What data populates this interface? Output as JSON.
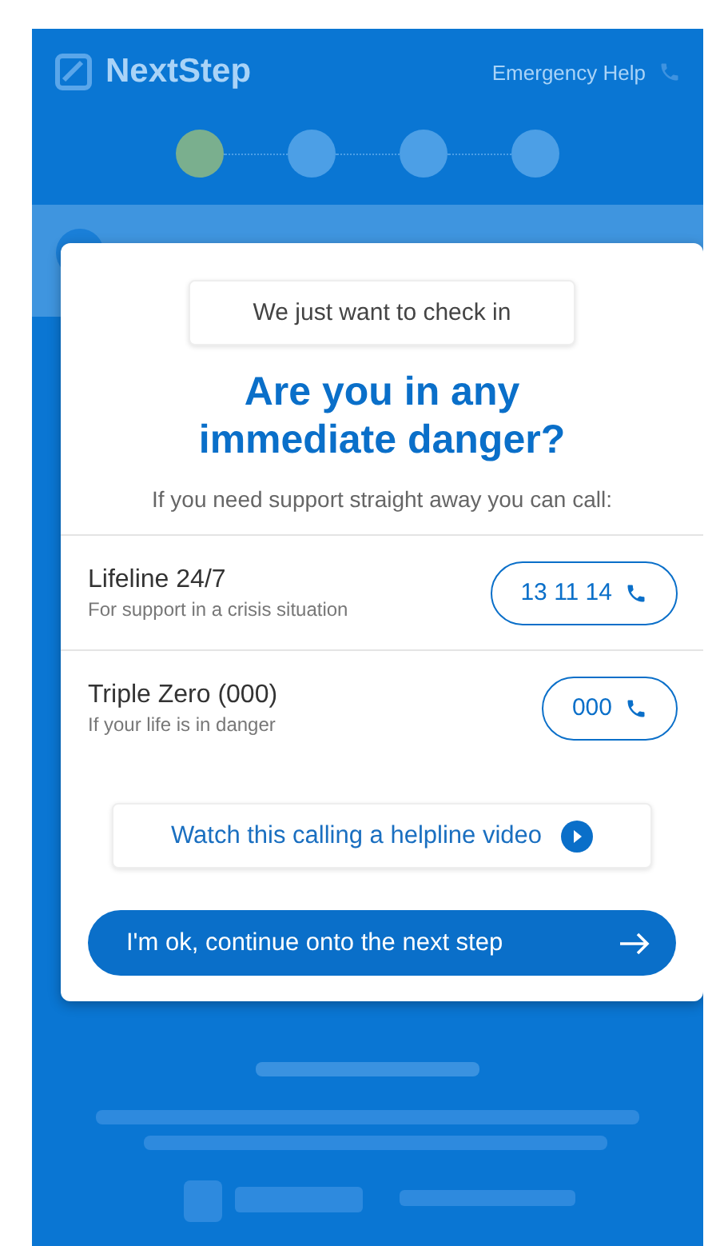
{
  "header": {
    "brand": "NextStep",
    "emergency_link": "Emergency Help"
  },
  "stepper": {
    "steps": [
      {
        "current": true
      },
      {
        "current": false
      },
      {
        "current": false
      },
      {
        "current": false
      }
    ]
  },
  "dialog": {
    "bubble": "We just want to check in",
    "title": "Are you in any immediate danger?",
    "intro": "If you need support straight away you can call:",
    "helplines": [
      {
        "name": "Lifeline 24/7",
        "description": "For support in a crisis situation",
        "number": "13 11 14"
      },
      {
        "name": "Triple Zero (000)",
        "description": "If your life is in danger",
        "number": "000"
      }
    ],
    "video_link": "Watch this calling a helpline video",
    "continue_button": "I'm ok, continue onto the next step"
  }
}
